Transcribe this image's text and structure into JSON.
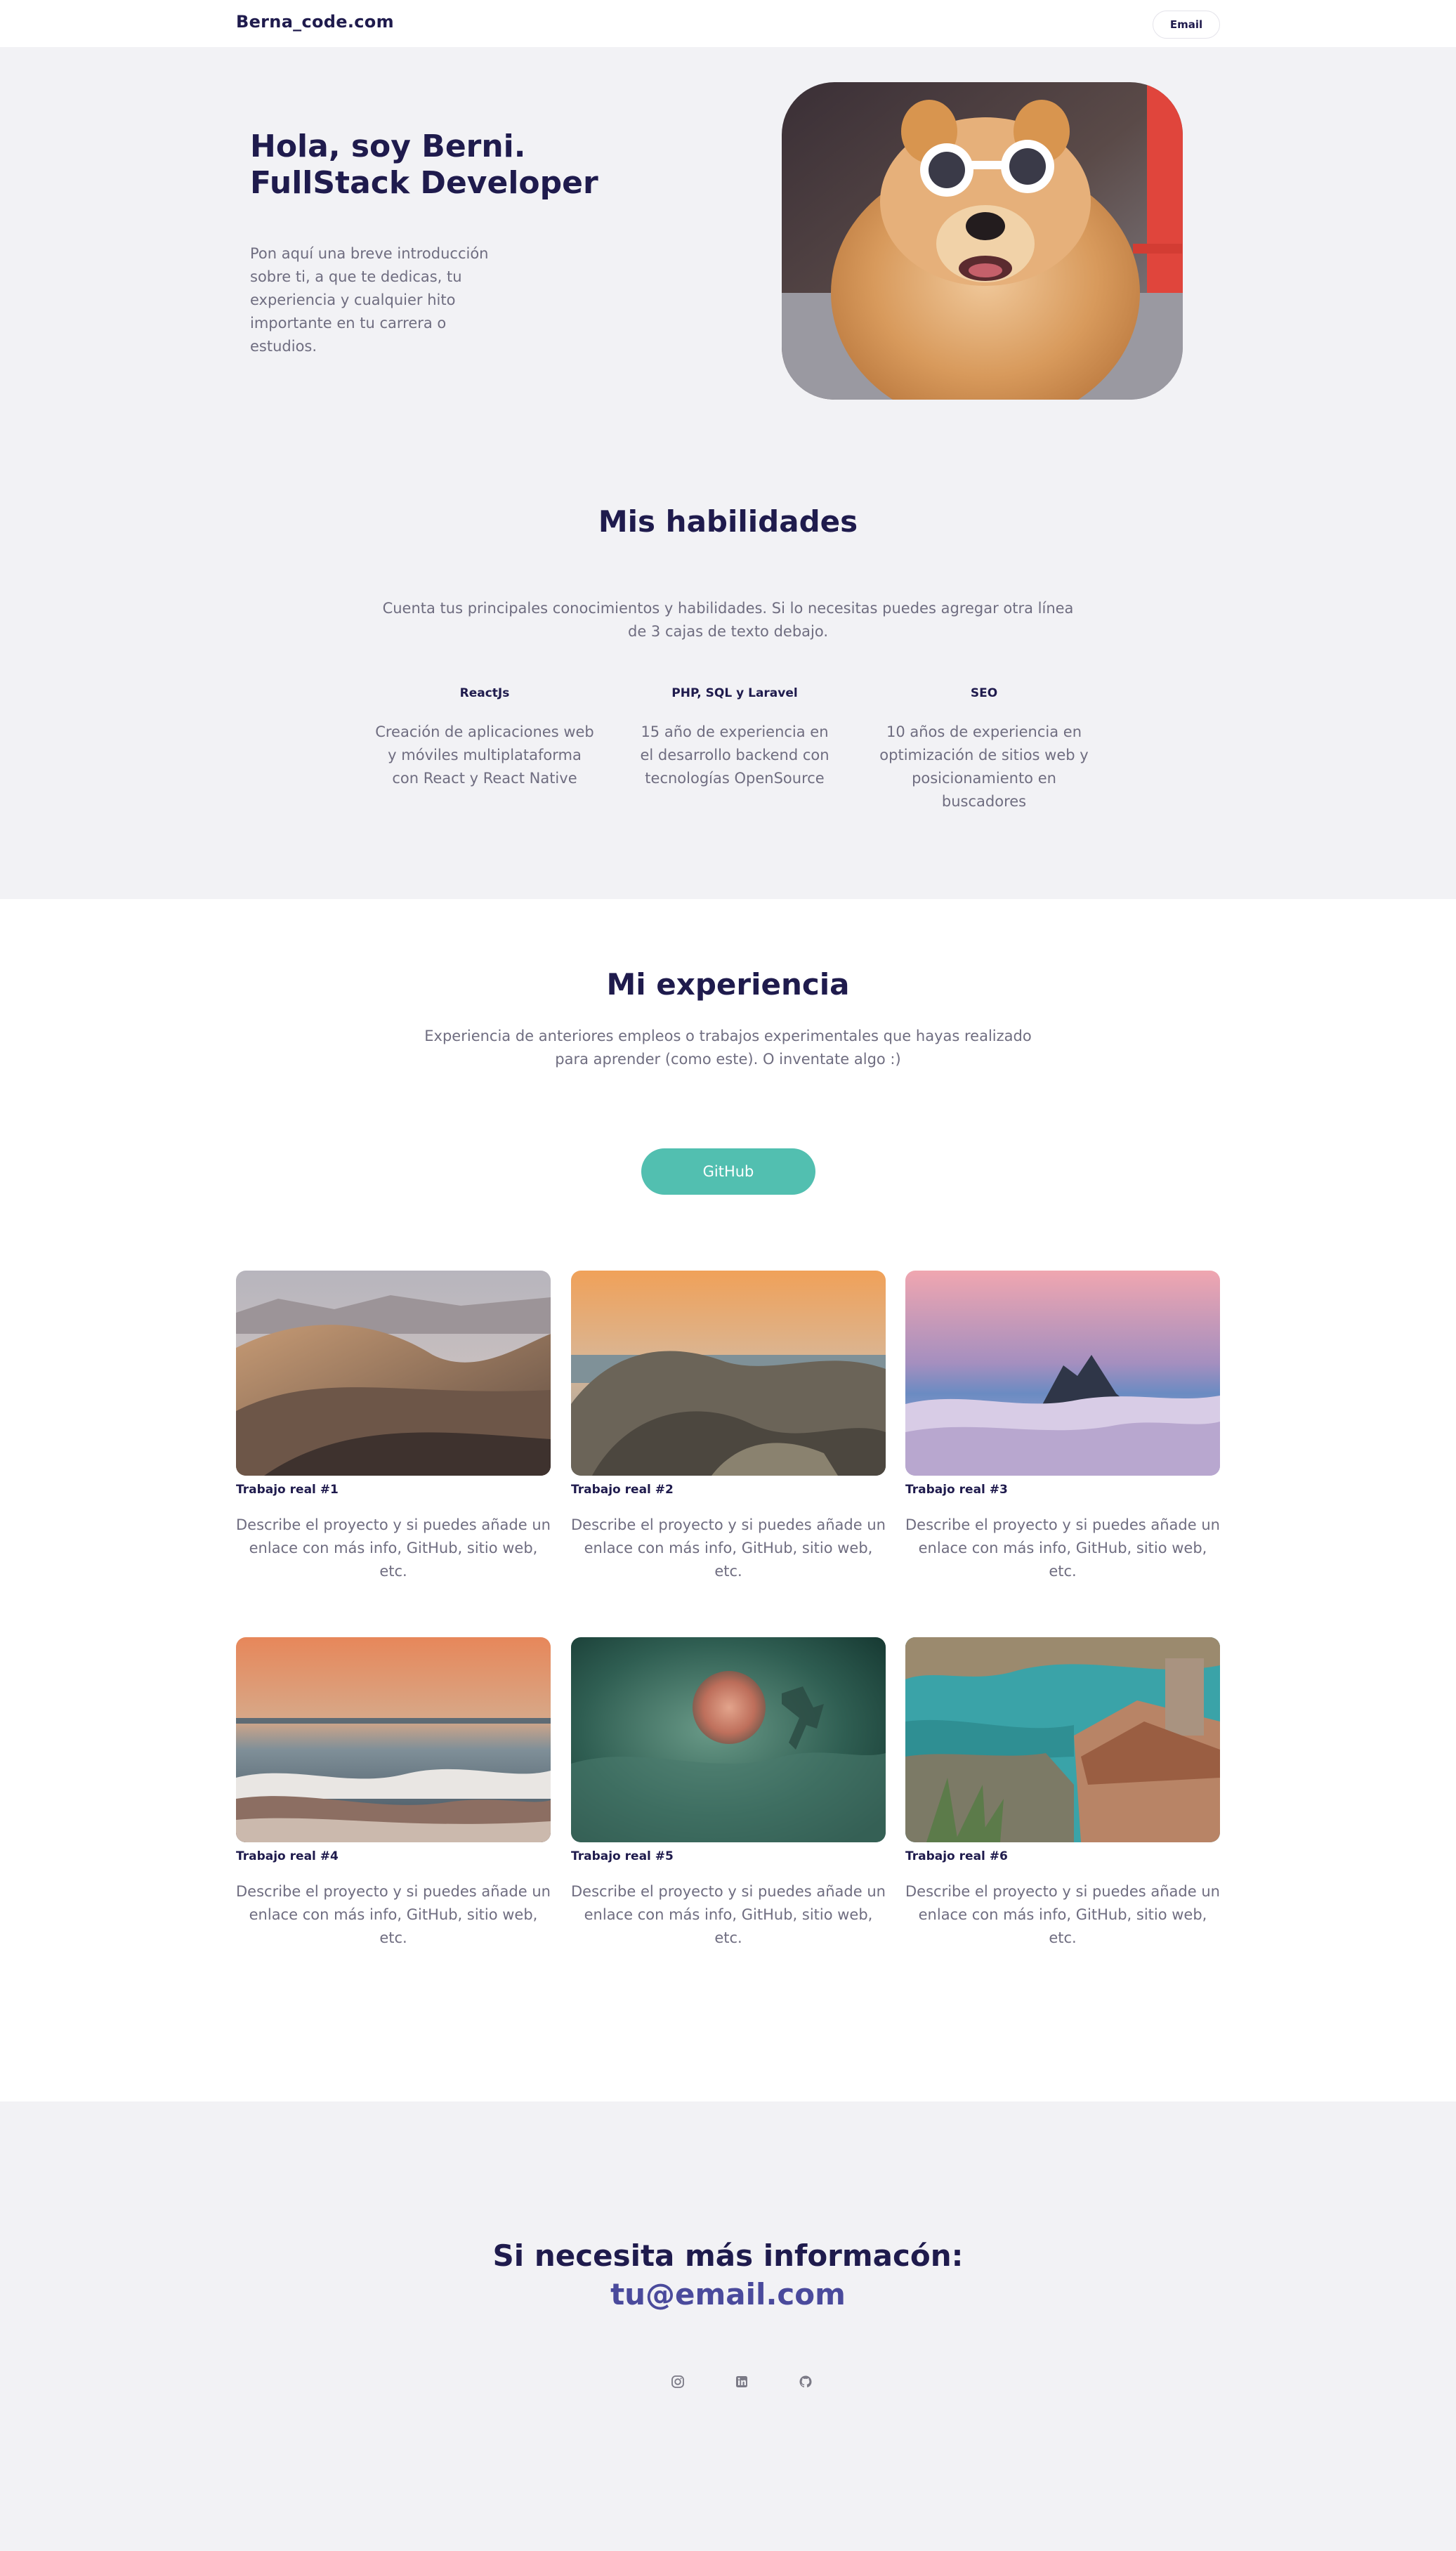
{
  "header": {
    "brand": "Berna_code.com",
    "email_button": "Email"
  },
  "hero": {
    "title_line1": "Hola, soy Berni.",
    "title_line2": "FullStack Developer",
    "intro": "Pon aquí una breve introducción sobre ti, a que te dedicas, tu experiencia y cualquier hito importante en tu carrera o estudios."
  },
  "skills": {
    "title": "Mis habilidades",
    "lead": "Cuenta tus principales conocimientos y habilidades. Si lo necesitas puedes agregar otra línea de 3 cajas de texto debajo.",
    "items": [
      {
        "name": "ReactJs",
        "description": "Creación de aplicaciones web y móviles multiplataforma con React y React Native"
      },
      {
        "name": "PHP, SQL y Laravel",
        "description": "15 año de experiencia en el desarrollo backend con tecnologías OpenSource"
      },
      {
        "name": "SEO",
        "description": "10 años de experiencia en optimización de sitios web y posicionamiento en buscadores"
      }
    ]
  },
  "experience": {
    "title": "Mi experiencia",
    "lead": "Experiencia de anteriores empleos o trabajos experimentales que hayas realizado para aprender (como este). O inventate algo :)",
    "github_button": "GitHub",
    "projects": [
      {
        "title": "Trabajo real #1",
        "description": "Describe el proyecto y si puedes añade un enlace con más info, GitHub, sitio web, etc."
      },
      {
        "title": "Trabajo real #2",
        "description": "Describe el proyecto y si puedes añade un enlace con más info, GitHub, sitio web, etc."
      },
      {
        "title": "Trabajo real #3",
        "description": "Describe el proyecto y si puedes añade un enlace con más info, GitHub, sitio web, etc."
      },
      {
        "title": "Trabajo real #4",
        "description": "Describe el proyecto y si puedes añade un enlace con más info, GitHub, sitio web, etc."
      },
      {
        "title": "Trabajo real #5",
        "description": "Describe el proyecto y si puedes añade un enlace con más info, GitHub, sitio web, etc."
      },
      {
        "title": "Trabajo real #6",
        "description": "Describe el proyecto y si puedes añade un enlace con más info, GitHub, sitio web, etc."
      }
    ]
  },
  "contact": {
    "title": "Si necesita más informacón:",
    "email": "tu@email.com",
    "social_icons": [
      "instagram-icon",
      "linkedin-icon",
      "github-icon"
    ]
  },
  "colors": {
    "navy": "#1f1b4d",
    "accent_teal": "#52bfb0",
    "email_purple": "#4a4a9c",
    "section_grey": "#f2f2f5",
    "body_text": "#6f6d80"
  }
}
